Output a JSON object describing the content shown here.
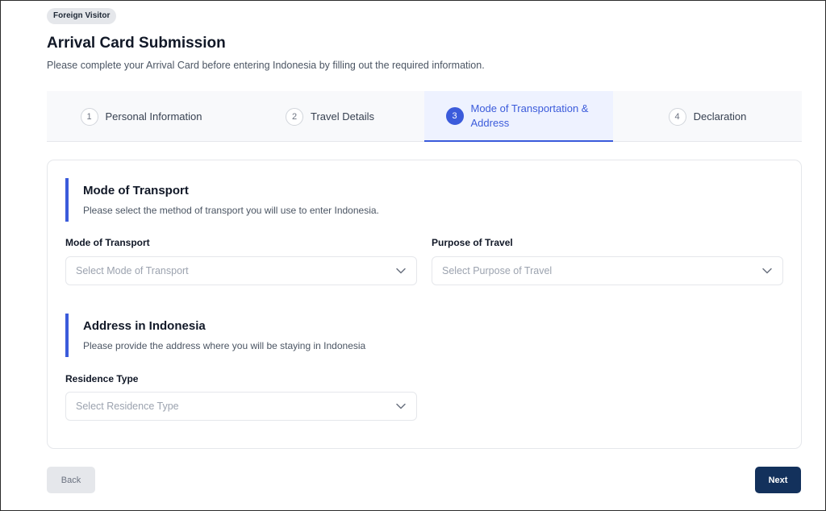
{
  "header": {
    "badge": "Foreign Visitor",
    "title": "Arrival Card Submission",
    "subtitle": "Please complete your Arrival Card before entering Indonesia by filling out the required information."
  },
  "steps": [
    {
      "number": "1",
      "label": "Personal Information",
      "active": false
    },
    {
      "number": "2",
      "label": "Travel Details",
      "active": false
    },
    {
      "number": "3",
      "label": "Mode of Transportation & Address",
      "active": true
    },
    {
      "number": "4",
      "label": "Declaration",
      "active": false
    }
  ],
  "transport_section": {
    "title": "Mode of Transport",
    "description": "Please select the method of transport you will use to enter Indonesia.",
    "mode_label": "Mode of Transport",
    "mode_placeholder": "Select Mode of Transport",
    "purpose_label": "Purpose of Travel",
    "purpose_placeholder": "Select Purpose of Travel"
  },
  "address_section": {
    "title": "Address in Indonesia",
    "description": "Please provide the address where you will be staying in Indonesia",
    "residence_label": "Residence Type",
    "residence_placeholder": "Select Residence Type"
  },
  "footer": {
    "back_label": "Back",
    "next_label": "Next"
  },
  "colors": {
    "accent": "#3b5bdb",
    "primary_button": "#13315c",
    "active_step_bg": "#eef2ff"
  },
  "icons": {
    "dropdown": "chevron-down-icon"
  }
}
